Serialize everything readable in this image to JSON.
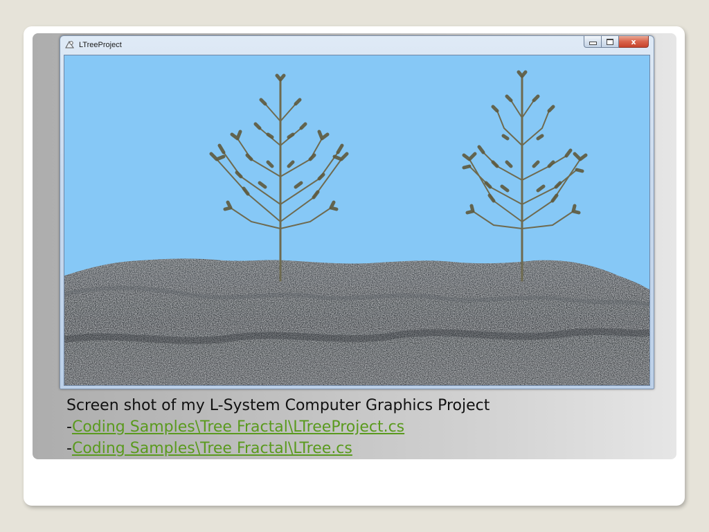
{
  "window": {
    "title": "LTreeProject",
    "buttons": {
      "minimize": "minimize",
      "maximize": "maximize",
      "close": "x"
    }
  },
  "colors": {
    "sky": "#86c8f6",
    "terrain": "#3f4347",
    "link": "#5a9a1e",
    "trunk": "#6e6a4f",
    "foliage": "#5f5a3e"
  },
  "caption": {
    "text": "Screen shot of my L-System Computer Graphics Project",
    "links": [
      {
        "prefix": "-",
        "label": "Coding Samples\\Tree Fractal\\LTreeProject.cs"
      },
      {
        "prefix": "-",
        "label": "Coding Samples\\Tree Fractal\\LTree.cs"
      }
    ]
  }
}
